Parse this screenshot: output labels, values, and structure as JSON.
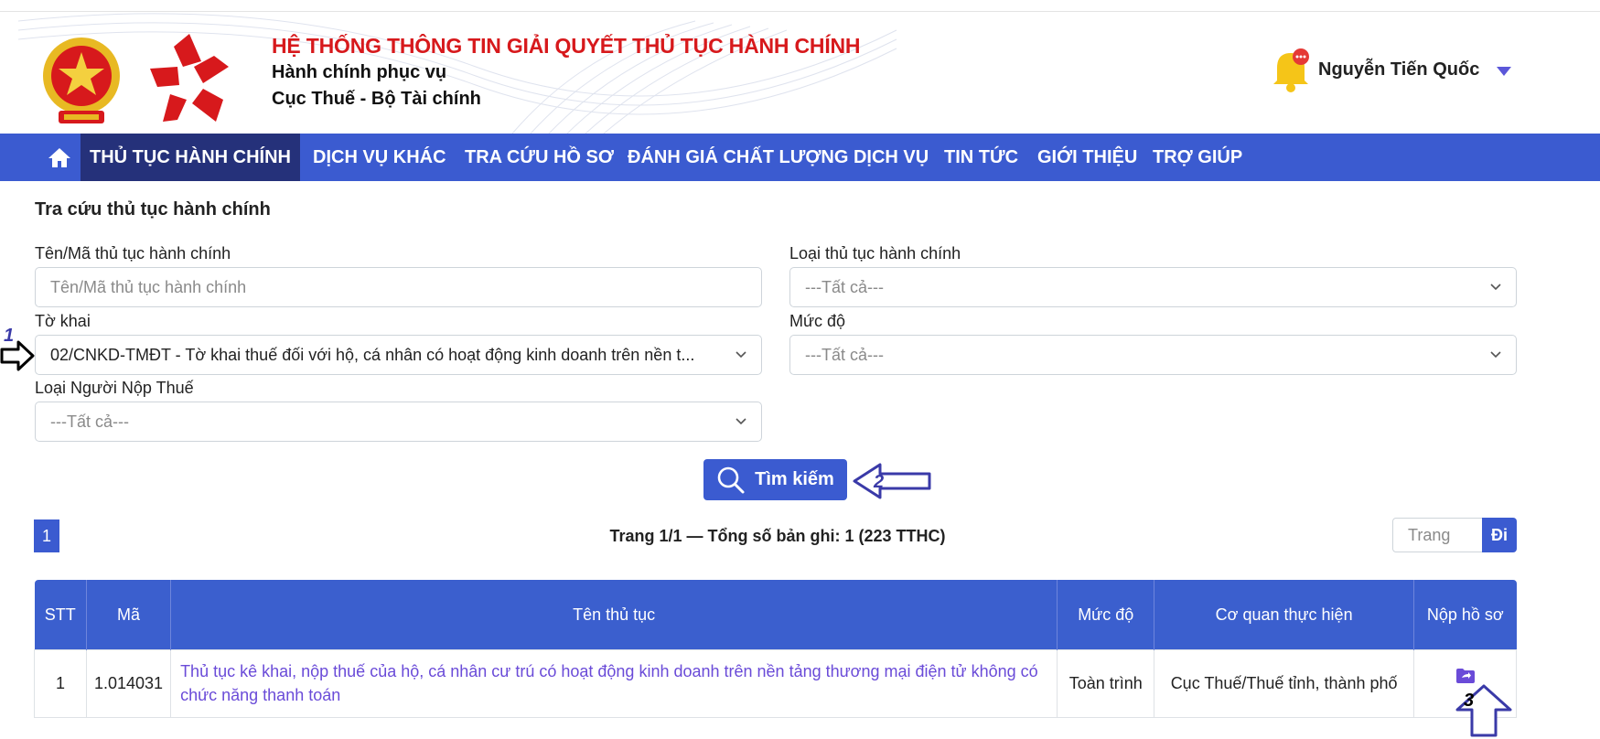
{
  "header": {
    "system_title": "HỆ THỐNG THÔNG TIN GIẢI QUYẾT THỦ TỤC HÀNH CHÍNH",
    "subtitle_1": "Hành chính phục vụ",
    "subtitle_2": "Cục Thuế - Bộ Tài chính",
    "user_name": "Nguyễn Tiến Quốc"
  },
  "nav": {
    "items": [
      {
        "label": "THỦ TỤC HÀNH CHÍNH",
        "active": true
      },
      {
        "label": "DỊCH VỤ KHÁC"
      },
      {
        "label": "TRA CỨU HỒ SƠ"
      },
      {
        "label": "ĐÁNH GIÁ CHẤT LƯỢNG DỊCH VỤ"
      },
      {
        "label": "TIN TỨC"
      },
      {
        "label": "GIỚI THIỆU"
      },
      {
        "label": "TRỢ GIÚP"
      }
    ]
  },
  "search_form": {
    "section_title": "Tra cứu thủ tục hành chính",
    "name_code_label": "Tên/Mã thủ tục hành chính",
    "name_code_placeholder": "Tên/Mã thủ tục hành chính",
    "procedure_type_label": "Loại thủ tục hành chính",
    "procedure_type_value": "---Tất cả---",
    "declaration_label": "Tờ khai",
    "declaration_value": "02/CNKD-TMĐT - Tờ khai thuế đối với hộ, cá nhân có hoạt động kinh doanh trên nền t...",
    "level_label": "Mức độ",
    "level_value": "---Tất cả---",
    "taxpayer_type_label": "Loại Người Nộp Thuế",
    "taxpayer_type_value": "---Tất cả---",
    "search_button": "Tìm kiếm"
  },
  "annotations": [
    "1",
    "2",
    "3"
  ],
  "pagination": {
    "current_page": "1",
    "summary": "Trang 1/1 — Tổng số bản ghi: 1 (223 TTHC)",
    "goto_placeholder": "Trang",
    "goto_button": "Đi"
  },
  "table": {
    "headers": [
      "STT",
      "Mã",
      "Tên thủ tục",
      "Mức độ",
      "Cơ quan thực hiện",
      "Nộp hồ sơ"
    ],
    "rows": [
      {
        "stt": "1",
        "code": "1.014031",
        "name": "Thủ tục kê khai, nộp thuế của hộ, cá nhân cư trú có hoạt động kinh doanh trên nền tảng thương mại điện tử không có chức năng thanh toán",
        "level": "Toàn trình",
        "agency": "Cục Thuế/Thuế tỉnh, thành phố",
        "submit_icon": "folder-submit-icon"
      }
    ]
  },
  "colors": {
    "brand_blue": "#3b5bd0",
    "nav_active": "#25317a",
    "title_red": "#d7191c",
    "link_purple": "#6a4bd8"
  }
}
